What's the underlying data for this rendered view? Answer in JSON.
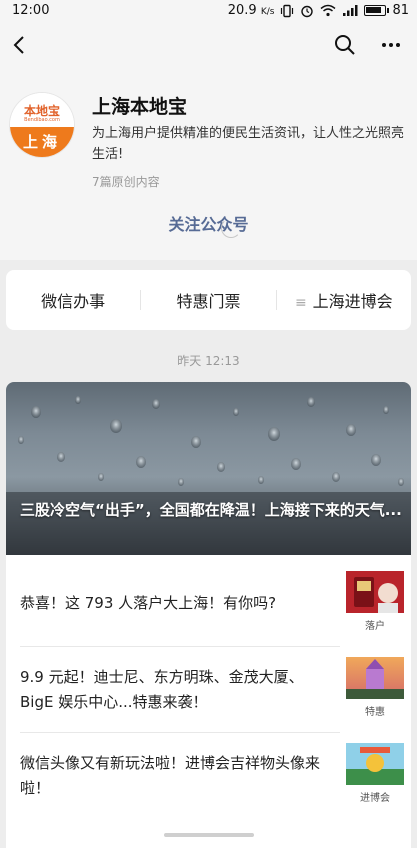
{
  "status_bar": {
    "time": "12:00",
    "network_speed": "20.9",
    "speed_unit": "K/s",
    "battery": "81"
  },
  "nav": {
    "back_icon": "chevron-left-icon",
    "search_icon": "search-icon",
    "more_icon": "more-dots-icon"
  },
  "account": {
    "logo_brand": "本地宝",
    "logo_sub": "Bendibao.com",
    "logo_city": "上海",
    "name": "上海本地宝",
    "description": "为上海用户提供精准的便民生活资讯，让人性之光照亮生活!",
    "original_count": "7篇原创内容",
    "follow_label": "关注公众号"
  },
  "menu": {
    "items": [
      {
        "label": "微信办事"
      },
      {
        "label": "特惠门票"
      },
      {
        "label": "上海进博会"
      }
    ]
  },
  "feed": {
    "timestamp": "昨天 12:13",
    "hero": {
      "title": "三股冷空气“出手”，全国都在降温！上海接下来的天气..."
    },
    "items": [
      {
        "title": "恭喜！这 793 人落户大上海！有你吗?",
        "thumb_label": "落户"
      },
      {
        "title": "9.9 元起！迪士尼、东方明珠、金茂大厦、BigE 娱乐中心...特惠来袭！",
        "thumb_label": "特惠"
      },
      {
        "title": "微信头像又有新玩法啦！进博会吉祥物头像来啦！",
        "thumb_label": "进博会"
      }
    ]
  },
  "colors": {
    "link": "#576b95",
    "logo_orange": "#ee7a1c",
    "background": "#ededed"
  }
}
